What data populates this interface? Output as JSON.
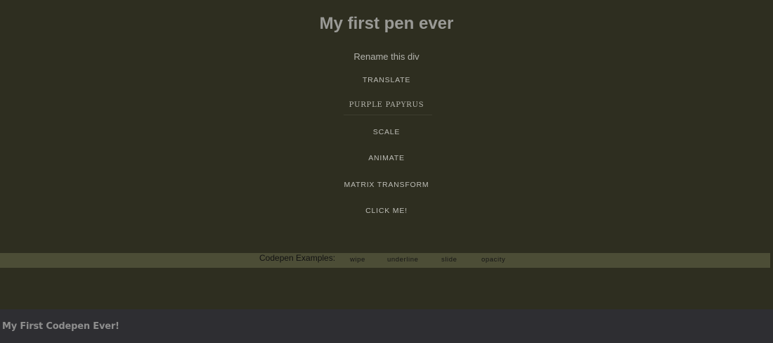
{
  "header": {
    "title": "My first pen ever",
    "rename_text": "Rename this div"
  },
  "menu": {
    "items": [
      {
        "label": "TRANSLATE"
      },
      {
        "label": "PURPLE PAPYRUS"
      },
      {
        "label": "SCALE"
      },
      {
        "label": "ANIMATE"
      },
      {
        "label": "MATRIX TRANSFORM"
      },
      {
        "label": "CLICK ME!"
      }
    ]
  },
  "examples": {
    "label": "Codepen Examples:",
    "links": [
      {
        "label": "wipe"
      },
      {
        "label": "underline"
      },
      {
        "label": "slide"
      },
      {
        "label": "opacity"
      }
    ]
  },
  "footer": {
    "title": "My First Codepen Ever!"
  },
  "colors": {
    "background": "#2e2e20",
    "examples_bar": "#4c4d36",
    "footer_bg": "#2e2e32",
    "title_text": "#9a9a96",
    "menu_text": "#bdbdb6"
  }
}
